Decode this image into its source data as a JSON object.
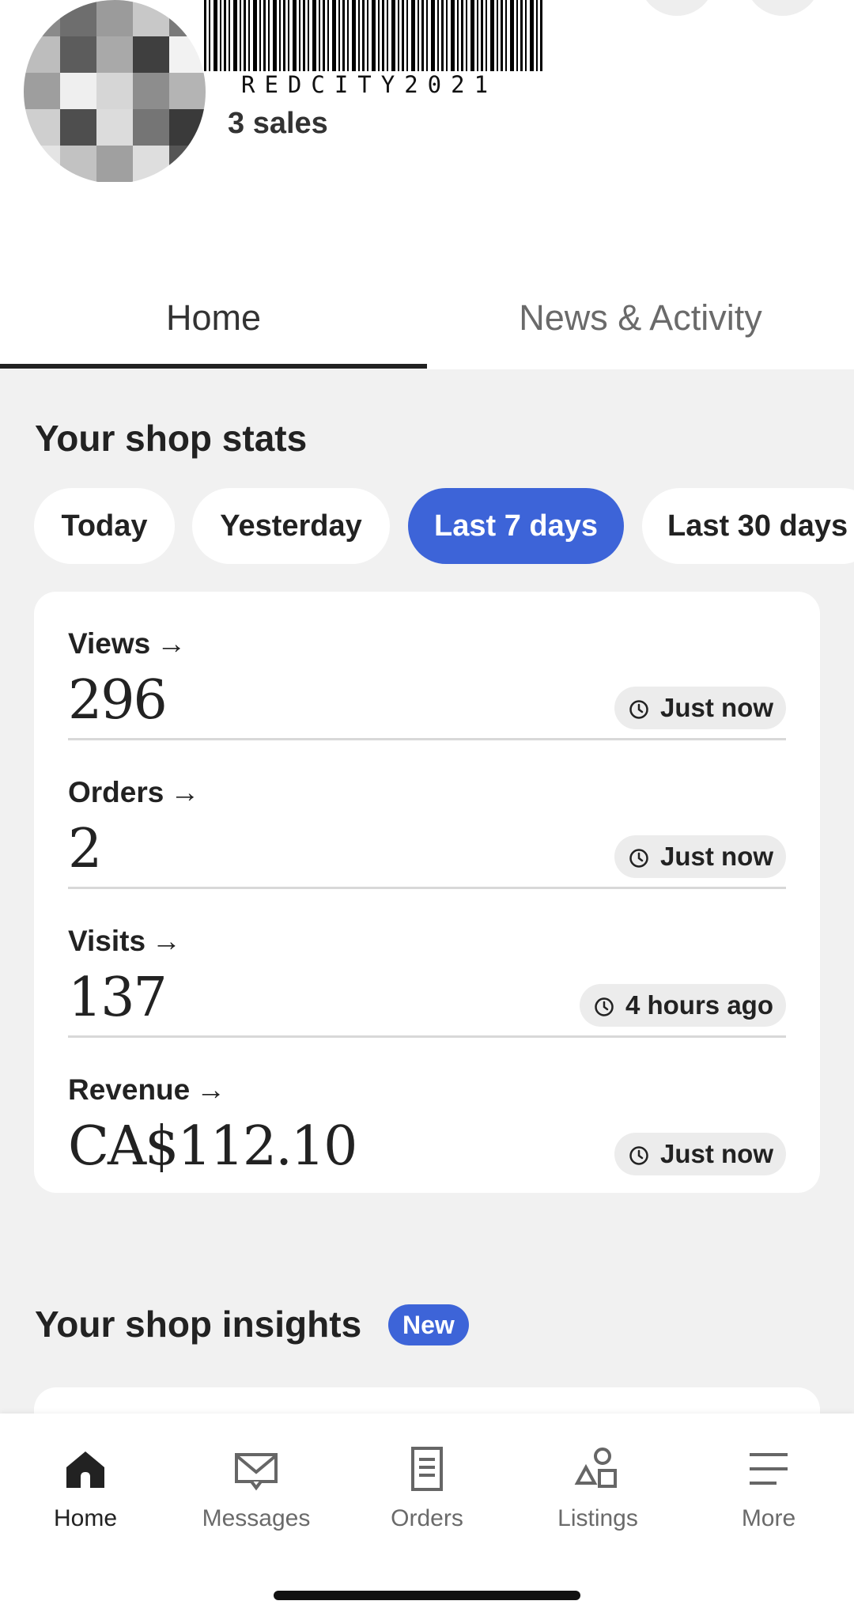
{
  "header": {
    "shop_code": "REDCITY2021",
    "sales": "3 sales"
  },
  "tabs": [
    {
      "label": "Home",
      "active": true
    },
    {
      "label": "News & Activity",
      "active": false
    }
  ],
  "stats": {
    "title": "Your shop stats",
    "ranges": [
      {
        "label": "Today",
        "active": false
      },
      {
        "label": "Yesterday",
        "active": false
      },
      {
        "label": "Last 7 days",
        "active": true
      },
      {
        "label": "Last 30 days",
        "active": false
      }
    ],
    "rows": [
      {
        "label": "Views",
        "value": "296",
        "updated": "Just now"
      },
      {
        "label": "Orders",
        "value": "2",
        "updated": "Just now"
      },
      {
        "label": "Visits",
        "value": "137",
        "updated": "4 hours ago"
      },
      {
        "label": "Revenue",
        "value": "CA$112.10",
        "updated": "Just now"
      }
    ]
  },
  "insights": {
    "title": "Your shop insights",
    "badge": "New"
  },
  "nav": {
    "items": [
      {
        "label": "Home",
        "icon": "home-icon",
        "active": true
      },
      {
        "label": "Messages",
        "icon": "envelope-icon",
        "active": false
      },
      {
        "label": "Orders",
        "icon": "receipt-icon",
        "active": false
      },
      {
        "label": "Listings",
        "icon": "shapes-icon",
        "active": false
      },
      {
        "label": "More",
        "icon": "menu-icon",
        "active": false
      }
    ]
  },
  "colors": {
    "accent": "#3d64d8",
    "background": "#f1f1f1",
    "text": "#222222",
    "muted": "#6a6a6a"
  }
}
